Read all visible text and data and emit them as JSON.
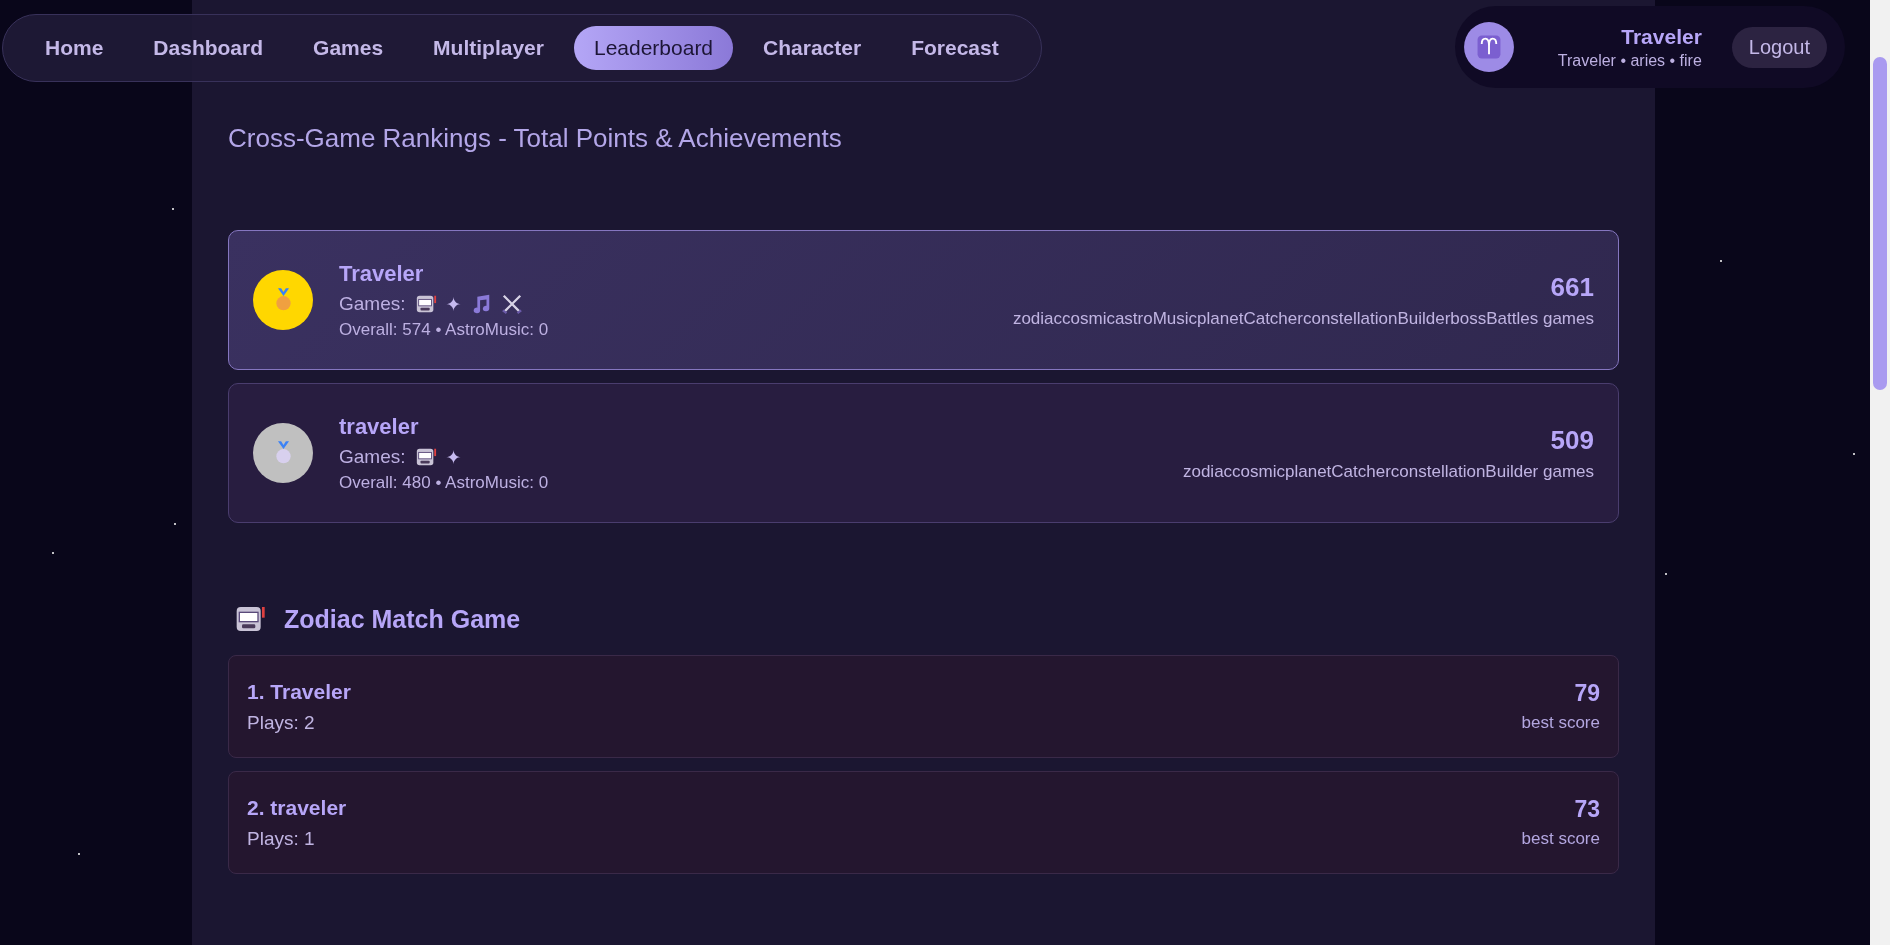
{
  "nav": {
    "items": [
      {
        "label": "Home",
        "selected": false
      },
      {
        "label": "Dashboard",
        "selected": false
      },
      {
        "label": "Games",
        "selected": false
      },
      {
        "label": "Multiplayer",
        "selected": false
      },
      {
        "label": "Leaderboard",
        "selected": true
      },
      {
        "label": "Character",
        "selected": false
      },
      {
        "label": "Forecast",
        "selected": false
      }
    ]
  },
  "user": {
    "name": "Traveler",
    "details": "Traveler • aries • fire",
    "logout": "Logout"
  },
  "subtitle": "Cross-Game Rankings - Total Points & Achievements",
  "overall": [
    {
      "name": "Traveler",
      "color": "#ffd700",
      "highlighted": true,
      "games_label": "Games:",
      "games": [
        {
          "kind": "slot"
        },
        {
          "kind": "glyph",
          "text": "✦"
        },
        {
          "kind": "music"
        },
        {
          "kind": "swords"
        }
      ],
      "stats": "Overall: 574 • AstroMusic: 0",
      "points": "661",
      "games_list": "zodiaccosmicastroMusicplanetCatcherconstellationBuilderbossBattles games"
    },
    {
      "name": "traveler",
      "color": "#c0c0c0",
      "highlighted": false,
      "games_label": "Games:",
      "games": [
        {
          "kind": "slot"
        },
        {
          "kind": "glyph",
          "text": "✦"
        }
      ],
      "stats": "Overall: 480 • AstroMusic: 0",
      "points": "509",
      "games_list": "zodiaccosmicplanetCatcherconstellationBuilder games"
    }
  ],
  "sections": [
    {
      "title": "Zodiac Match Game",
      "rows": [
        {
          "name": "1. Traveler",
          "plays": "Plays: 2",
          "score": "79",
          "score_label": "best score"
        },
        {
          "name": "2. traveler",
          "plays": "Plays: 1",
          "score": "73",
          "score_label": "best score"
        }
      ]
    }
  ]
}
